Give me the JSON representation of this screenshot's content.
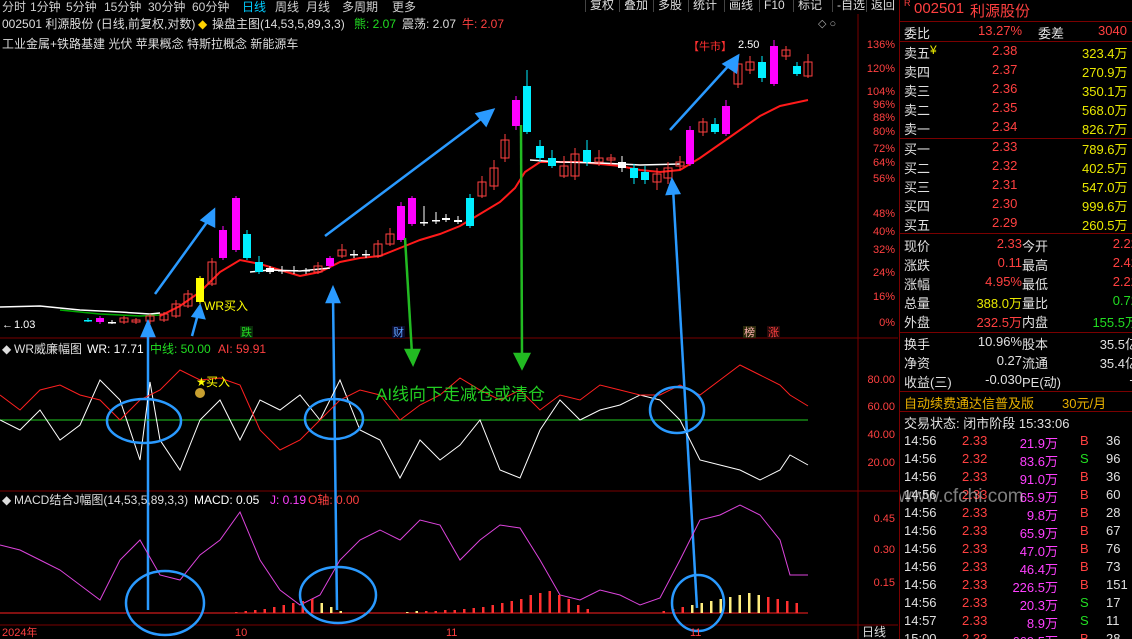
{
  "toolbar": {
    "timeframes": [
      "分时",
      "1分钟",
      "5分钟",
      "15分钟",
      "30分钟",
      "60分钟",
      "日线",
      "周线",
      "月线",
      "多周期",
      "更多"
    ],
    "selected_timeframe": "日线",
    "buttons": [
      "复权",
      "叠加",
      "多股",
      "统计",
      "画线",
      "F10",
      "-自选",
      "返回"
    ]
  },
  "main_chart": {
    "header_stock": "002501 利源股份 (日线,前复权,对数)",
    "indicator_name": "操盘主图(14,53,5,89,3,3)",
    "bull_label": "熊: 2.07",
    "swing_label": "震荡: 2.07",
    "bull2_label": "牛: 2.07",
    "concepts": "工业金属+铁路基建 光伏 苹果概念 特斯拉概念 新能源车",
    "bull_market_tag": "【牛市】",
    "high_price_label": "2.50",
    "low_price_label": "1.03",
    "wr_buy_label": "WR买入",
    "fall_tag": "跌",
    "finance_tag": "财",
    "rank_tag": "榜",
    "rise_tag": "涨",
    "price_scale": [
      "136%",
      "120%",
      "104%",
      "96%",
      "88%",
      "80%",
      "72%",
      "64%",
      "56%",
      "48%",
      "40%",
      "32%",
      "24%",
      "16%",
      "8%",
      "0%"
    ]
  },
  "wr_panel": {
    "title": "WR威廉幅图",
    "wr_value": "WR: 17.71",
    "mid_value": "中线: 50.00",
    "ai_value": "AI: 59.91",
    "buy_label": "买入",
    "annotation": "AI线向下走减仓或清仓",
    "scale": [
      "80.00",
      "60.00",
      "40.00",
      "20.00"
    ]
  },
  "macd_panel": {
    "title": "MACD结合J幅图(14,53,5,89,3,3)",
    "macd_value": "MACD: 0.05",
    "j_value": "J: 0.19",
    "o_value": "O轴: 0.00",
    "scale": [
      "0.45",
      "0.30",
      "0.15"
    ]
  },
  "x_axis": {
    "labels": [
      "2024年",
      "10",
      "11",
      "11"
    ],
    "period_label": "日线"
  },
  "quote_panel": {
    "code": "002501",
    "name": "利源股份",
    "wei_bi_label": "委比",
    "wei_bi": "13.27%",
    "wei_cha_label": "委差",
    "wei_cha": "3040",
    "asks": [
      {
        "label": "卖五",
        "price": "2.38",
        "vol": "323.4万"
      },
      {
        "label": "卖四",
        "price": "2.37",
        "vol": "270.9万"
      },
      {
        "label": "卖三",
        "price": "2.36",
        "vol": "350.1万"
      },
      {
        "label": "卖二",
        "price": "2.35",
        "vol": "568.0万"
      },
      {
        "label": "卖一",
        "price": "2.34",
        "vol": "826.7万"
      }
    ],
    "bids": [
      {
        "label": "买一",
        "price": "2.33",
        "vol": "789.6万"
      },
      {
        "label": "买二",
        "price": "2.32",
        "vol": "402.5万"
      },
      {
        "label": "买三",
        "price": "2.31",
        "vol": "547.0万"
      },
      {
        "label": "买四",
        "price": "2.30",
        "vol": "999.6万"
      },
      {
        "label": "买五",
        "price": "2.29",
        "vol": "260.5万"
      }
    ],
    "stats": [
      {
        "l1": "现价",
        "v1": "2.33",
        "l2": "今开",
        "v2": "2.22"
      },
      {
        "l1": "涨跌",
        "v1": "0.11",
        "l2": "最高",
        "v2": "2.42"
      },
      {
        "l1": "涨幅",
        "v1": "4.95%",
        "l2": "最低",
        "v2": "2.22"
      },
      {
        "l1": "总量",
        "v1": "388.0万",
        "l2": "量比",
        "v2": "0.72"
      },
      {
        "l1": "外盘",
        "v1": "232.5万",
        "l2": "内盘",
        "v2": "155.5万"
      }
    ],
    "stats2": [
      {
        "l1": "换手",
        "v1": "10.96%",
        "l2": "股本",
        "v2": "35.5亿"
      },
      {
        "l1": "净资",
        "v1": "0.27",
        "l2": "流通",
        "v2": "35.4亿"
      },
      {
        "l1": "收益(三)",
        "v1": "-0.030",
        "l2": "PE(动)",
        "v2": "--"
      }
    ],
    "promo": "自动续费通达信普及版",
    "promo_price": "30元/月",
    "trade_state": "交易状态: 闭市阶段 15:33:06",
    "watermark": "www.cfchi.com",
    "ticks": [
      {
        "t": "14:56",
        "p": "2.33",
        "v": "21.9万",
        "s": "B",
        "n": "36"
      },
      {
        "t": "14:56",
        "p": "2.32",
        "v": "83.6万",
        "s": "S",
        "n": "96"
      },
      {
        "t": "14:56",
        "p": "2.33",
        "v": "91.0万",
        "s": "B",
        "n": "36"
      },
      {
        "t": "14:56",
        "p": "2.33",
        "v": "65.9万",
        "s": "B",
        "n": "60"
      },
      {
        "t": "14:56",
        "p": "2.33",
        "v": "9.8万",
        "s": "B",
        "n": "28"
      },
      {
        "t": "14:56",
        "p": "2.33",
        "v": "65.9万",
        "s": "B",
        "n": "67"
      },
      {
        "t": "14:56",
        "p": "2.33",
        "v": "47.0万",
        "s": "B",
        "n": "76"
      },
      {
        "t": "14:56",
        "p": "2.33",
        "v": "46.4万",
        "s": "B",
        "n": "73"
      },
      {
        "t": "14:56",
        "p": "2.33",
        "v": "226.5万",
        "s": "B",
        "n": "151"
      },
      {
        "t": "14:56",
        "p": "2.33",
        "v": "20.3万",
        "s": "S",
        "n": "17"
      },
      {
        "t": "14:57",
        "p": "2.33",
        "v": "8.9万",
        "s": "S",
        "n": "11"
      },
      {
        "t": "15:00",
        "p": "2.33",
        "v": "669.5万",
        "s": "B",
        "n": "28"
      }
    ]
  }
}
